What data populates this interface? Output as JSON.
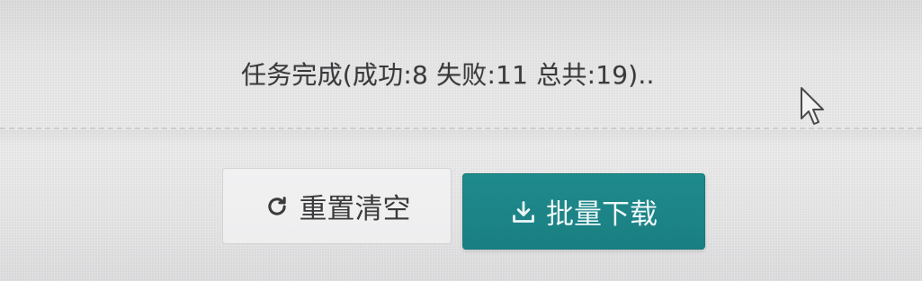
{
  "status": {
    "text": "任务完成(成功:8 失败:11 总共:19).."
  },
  "buttons": {
    "reset": {
      "label": "重置清空",
      "icon": "refresh-icon"
    },
    "download": {
      "label": "批量下载",
      "icon": "download-icon"
    }
  },
  "colors": {
    "primary": "#1a7f82",
    "text": "#3a3a3c",
    "background": "#eaeaeb"
  }
}
